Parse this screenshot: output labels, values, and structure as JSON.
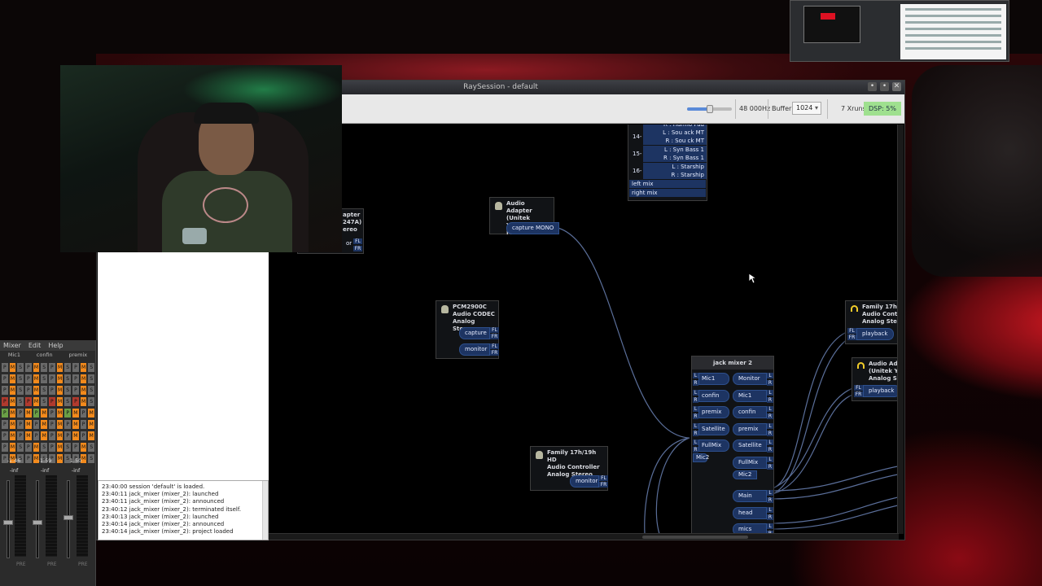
{
  "window": {
    "title": "RaySession - default"
  },
  "toolbar": {
    "sample_rate": "48 000Hz",
    "buffer_label": "Buffer:",
    "buffer_value": "1024",
    "xruns": "7 Xruns",
    "dsp": "DSP: 5%"
  },
  "boxes": {
    "adapter_left": {
      "line1": "apter",
      "line2": "247A)",
      "line3": "ereo",
      "port": "or",
      "ch1": "FL",
      "ch2": "FR"
    },
    "adapter_mono": {
      "title1": "Audio Adapter",
      "title2": "(Unitek",
      "title3": "Y-247A) Mono",
      "port": "capture MONO"
    },
    "pcm": {
      "title1": "PCM2900C",
      "title2": "Audio CODEC",
      "title3": "Analog Stereo",
      "port1": "capture",
      "port2": "monitor",
      "ch1": "FL",
      "ch2": "FR"
    },
    "family_hd": {
      "title1": "Family 17h/19h HD",
      "title2": "Audio Controller",
      "title3": "Analog Stereo",
      "port": "monitor",
      "ch1": "FL",
      "ch2": "FR"
    },
    "family_right": {
      "title1": "Family 17h/",
      "title2": "Audio Contr",
      "title3": "Analog Ster",
      "port": "playback",
      "ch1": "FL",
      "ch2": "FR"
    },
    "adapter_right": {
      "title1": "Audio Ada",
      "title2": "(Unitek Y",
      "title3": "Analog St",
      "port": "playback",
      "ch1": "FL",
      "ch2": "FR"
    },
    "top_mixer": {
      "rows": [
        {
          "num": "",
          "l": "",
          "r": "R : Harmo Pad"
        },
        {
          "num": "14-",
          "l": "L : Sou   ack MT",
          "r": "R : Sou   ck MT"
        },
        {
          "num": "15-",
          "l": "L : Syn   Bass 1",
          "r": "R : Syn   Bass 1"
        },
        {
          "num": "16-",
          "l": "L : Starship",
          "r": "R : Starship"
        }
      ],
      "num13": "13-",
      "left_mix": "left mix",
      "right_mix": "right mix"
    },
    "jack_mixer": {
      "title": "jack mixer 2",
      "inputs": [
        "Mic1",
        "confin",
        "premix",
        "Satellite",
        "FullMix",
        "Mic2"
      ],
      "outputs": [
        "Monitor",
        "Mic1",
        "confin",
        "premix",
        "Satellite",
        "FullMix",
        "Mic2",
        "Main",
        "head",
        "mics"
      ]
    }
  },
  "log": [
    "23:40:00  session 'default' is loaded.",
    "23:40:11  jack_mixer (mixer_2): launched",
    "23:40:11  jack_mixer (mixer_2): announced",
    "23:40:12  jack_mixer (mixer_2): terminated itself.",
    "23:40:13  jack_mixer (mixer_2): launched",
    "23:40:14  jack_mixer (mixer_2): announced",
    "23:40:14  jack_mixer (mixer_2): project loaded"
  ],
  "mixer": {
    "menu": [
      "Mixer",
      "Edit",
      "Help"
    ],
    "strips": [
      "Mic1",
      "confin",
      "premix"
    ],
    "values": [
      "-1.46",
      "-1.59",
      "1.50"
    ],
    "peaks": [
      "-inf",
      "-inf",
      "-inf"
    ],
    "pre": [
      "PRE",
      "PRE",
      "PRE"
    ]
  }
}
